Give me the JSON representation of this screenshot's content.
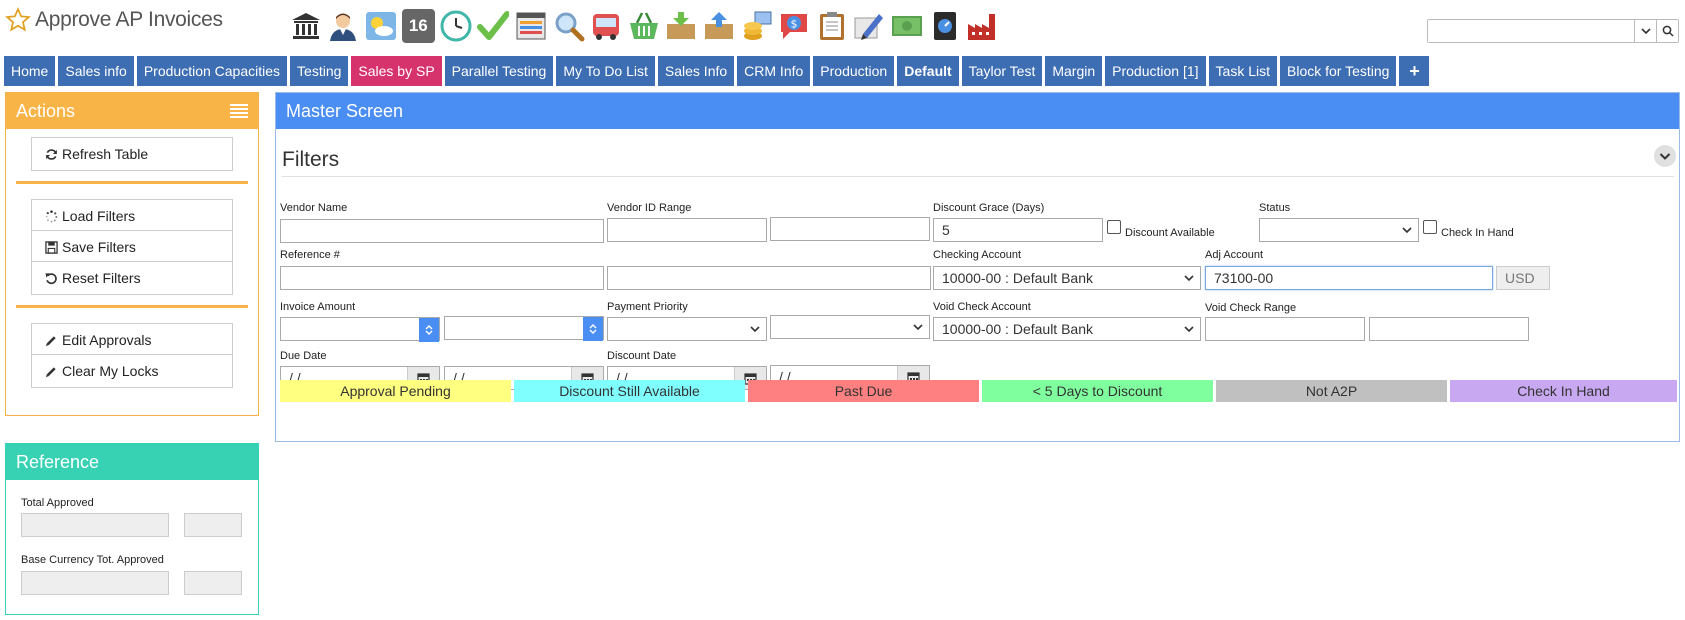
{
  "header": {
    "app_title": "Approve AP Invoices",
    "toolbar_icons": [
      "bank-icon",
      "user-icon",
      "weather-icon",
      "calendar-16-icon",
      "clock-icon",
      "checkmark-icon",
      "list-icon",
      "search-icon",
      "bus-icon",
      "basket-icon",
      "inbox-download-icon",
      "outbox-upload-icon",
      "coin-stack-icon",
      "dollar-chat-icon",
      "clipboard-icon",
      "pencil-icon",
      "cash-icon",
      "book-icon",
      "factory-icon"
    ],
    "calendar_day": "16",
    "search": {
      "value": "",
      "placeholder": ""
    }
  },
  "tabs": [
    {
      "label": "Home"
    },
    {
      "label": "Sales info"
    },
    {
      "label": "Production Capacities"
    },
    {
      "label": "Testing"
    },
    {
      "label": "Sales by SP",
      "style": "pink"
    },
    {
      "label": "Parallel Testing"
    },
    {
      "label": "My To Do List"
    },
    {
      "label": "Sales Info"
    },
    {
      "label": "CRM Info"
    },
    {
      "label": "Production"
    },
    {
      "label": "Default",
      "style": "bold"
    },
    {
      "label": "Taylor Test"
    },
    {
      "label": "Margin"
    },
    {
      "label": "Production [1]"
    },
    {
      "label": "Task List"
    },
    {
      "label": "Block for Testing"
    },
    {
      "label": "+",
      "style": "plus"
    }
  ],
  "actions": {
    "title": "Actions",
    "refresh": "Refresh Table",
    "load_filters": "Load Filters",
    "save_filters": "Save Filters",
    "reset_filters": "Reset Filters",
    "edit_approvals": "Edit Approvals",
    "clear_locks": "Clear My Locks"
  },
  "reference": {
    "title": "Reference",
    "total_approved": "Total Approved",
    "base_currency": "Base Currency Tot. Approved"
  },
  "master": {
    "title": "Master Screen",
    "filters_title": "Filters",
    "labels": {
      "vendor_name": "Vendor Name",
      "vendor_id_range": "Vendor ID Range",
      "discount_grace": "Discount Grace (Days)",
      "discount_available": "Discount Available",
      "status": "Status",
      "check_in_hand": "Check In Hand",
      "reference": "Reference #",
      "checking_account": "Checking Account",
      "adj_account": "Adj Account",
      "invoice_amount": "Invoice Amount",
      "payment_priority": "Payment Priority",
      "void_check_account": "Void Check Account",
      "void_check_range": "Void Check Range",
      "due_date": "Due Date",
      "discount_date": "Discount Date"
    },
    "values": {
      "discount_grace": "5",
      "checking_account": "10000-00 : Default Bank",
      "adj_account": "73100-00",
      "currency": "USD",
      "void_check_account": "10000-00 : Default Bank",
      "date_placeholder": "/ /"
    }
  },
  "legend": [
    {
      "label": "Approval Pending",
      "color": "#ffff80"
    },
    {
      "label": "Discount Still Available",
      "color": "#80ffff"
    },
    {
      "label": "Past Due",
      "color": "#ff8080"
    },
    {
      "label": "< 5 Days to Discount",
      "color": "#80ff9f"
    },
    {
      "label": "Not A2P",
      "color": "#c0c0c0"
    },
    {
      "label": "Check In Hand",
      "color": "#c8a8f0"
    }
  ],
  "colors": {
    "tab_blue": "#3d6db2",
    "tab_pink": "#d6336c",
    "actions_orange": "#f9b447",
    "reference_teal": "#37d1b4",
    "master_blue": "#4b8ef3"
  }
}
